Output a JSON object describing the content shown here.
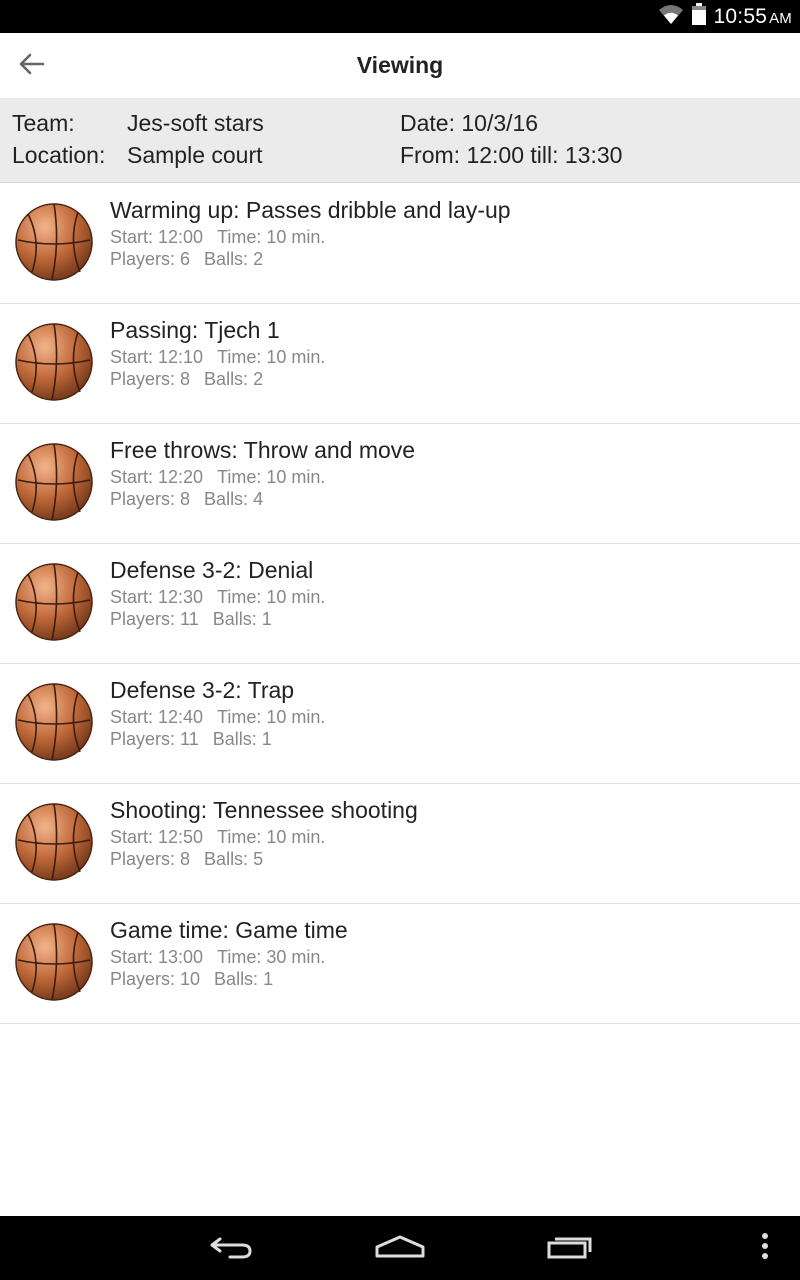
{
  "status_bar": {
    "time": "10:55",
    "ampm": "AM"
  },
  "app_bar": {
    "title": "Viewing"
  },
  "info": {
    "team_label": "Team:",
    "team_value": "Jes-soft stars",
    "location_label": "Location:",
    "location_value": "Sample court",
    "date": "Date: 10/3/16",
    "from_till": "From: 12:00 till: 13:30"
  },
  "drills": [
    {
      "title": "Warming up: Passes dribble and lay-up",
      "start": "Start: 12:00",
      "time": "Time: 10 min.",
      "players": "Players: 6",
      "balls": "Balls: 2"
    },
    {
      "title": "Passing: Tjech 1",
      "start": "Start: 12:10",
      "time": "Time: 10 min.",
      "players": "Players: 8",
      "balls": "Balls: 2"
    },
    {
      "title": "Free throws: Throw and move",
      "start": "Start: 12:20",
      "time": "Time: 10 min.",
      "players": "Players: 8",
      "balls": "Balls: 4"
    },
    {
      "title": "Defense 3-2: Denial",
      "start": "Start: 12:30",
      "time": "Time: 10 min.",
      "players": "Players: 11",
      "balls": "Balls: 1"
    },
    {
      "title": "Defense 3-2: Trap",
      "start": "Start: 12:40",
      "time": "Time: 10 min.",
      "players": "Players: 11",
      "balls": "Balls: 1"
    },
    {
      "title": "Shooting: Tennessee shooting",
      "start": "Start: 12:50",
      "time": "Time: 10 min.",
      "players": "Players: 8",
      "balls": "Balls: 5"
    },
    {
      "title": "Game time: Game time",
      "start": "Start: 13:00",
      "time": "Time: 30 min.",
      "players": "Players: 10",
      "balls": "Balls: 1"
    }
  ],
  "icons": {
    "wifi": "wifi-icon",
    "battery": "battery-icon",
    "back": "arrow-left-icon",
    "ball": "basketball-icon",
    "nav_back": "nav-back-icon",
    "nav_home": "nav-home-icon",
    "nav_recents": "nav-recents-icon",
    "nav_menu": "overflow-menu-icon"
  },
  "colors": {
    "header_bg": "#ebebeb",
    "ball": "#c0693a",
    "status_bar": "#000000"
  }
}
